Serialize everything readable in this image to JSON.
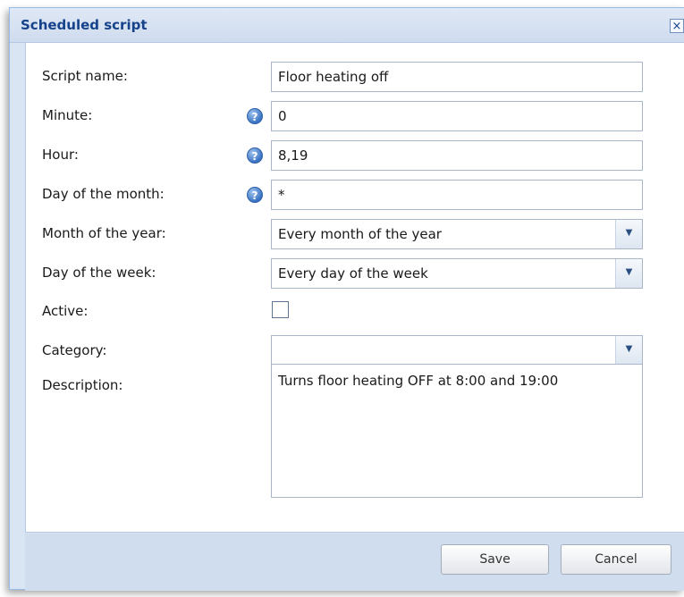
{
  "window": {
    "title": "Scheduled script",
    "close_glyph": "×"
  },
  "form": {
    "script_name": {
      "label": "Script name:",
      "value": "Floor heating off"
    },
    "minute": {
      "label": "Minute:",
      "value": "0",
      "help_icon": "question-icon"
    },
    "hour": {
      "label": "Hour:",
      "value": "8,19",
      "help_icon": "question-icon"
    },
    "day_of_month": {
      "label": "Day of the month:",
      "value": "*",
      "help_icon": "question-icon"
    },
    "month_of_year": {
      "label": "Month of the year:",
      "value": "Every month of the year"
    },
    "day_of_week": {
      "label": "Day of the week:",
      "value": "Every day of the week"
    },
    "active": {
      "label": "Active:",
      "checked": false
    },
    "category": {
      "label": "Category:",
      "value": ""
    },
    "description": {
      "label": "Description:",
      "value": "Turns floor heating OFF at 8:00 and 19:00"
    }
  },
  "buttons": {
    "save": "Save",
    "cancel": "Cancel"
  },
  "glyphs": {
    "help": "?",
    "dropdown": "▼"
  },
  "colors": {
    "title_text": "#15428b",
    "window_frame": "#d9e5f3",
    "footer": "#d0ddef"
  }
}
